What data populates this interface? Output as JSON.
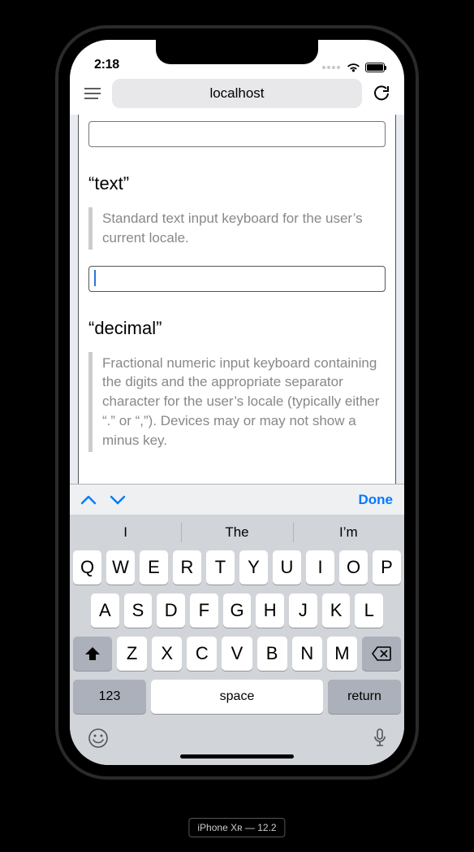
{
  "status": {
    "time": "2:18"
  },
  "browser": {
    "url_label": "localhost"
  },
  "content": {
    "sections": [
      {
        "heading": "“text”",
        "description": "Standard text input keyboard for the user’s current locale."
      },
      {
        "heading": "“decimal”",
        "description": "Fractional numeric input keyboard containing the digits and the appropriate separator character for the user’s locale (typically either “.” or “,”). Devices may or may not show a minus key."
      }
    ]
  },
  "keyboard": {
    "done_label": "Done",
    "suggestions": [
      "I",
      "The",
      "I’m"
    ],
    "rows": [
      [
        "Q",
        "W",
        "E",
        "R",
        "T",
        "Y",
        "U",
        "I",
        "O",
        "P"
      ],
      [
        "A",
        "S",
        "D",
        "F",
        "G",
        "H",
        "J",
        "K",
        "L"
      ],
      [
        "Z",
        "X",
        "C",
        "V",
        "B",
        "N",
        "M"
      ]
    ],
    "mode_key": "123",
    "space_key": "space",
    "return_key": "return"
  },
  "device_label": "iPhone Xʀ — 12.2"
}
